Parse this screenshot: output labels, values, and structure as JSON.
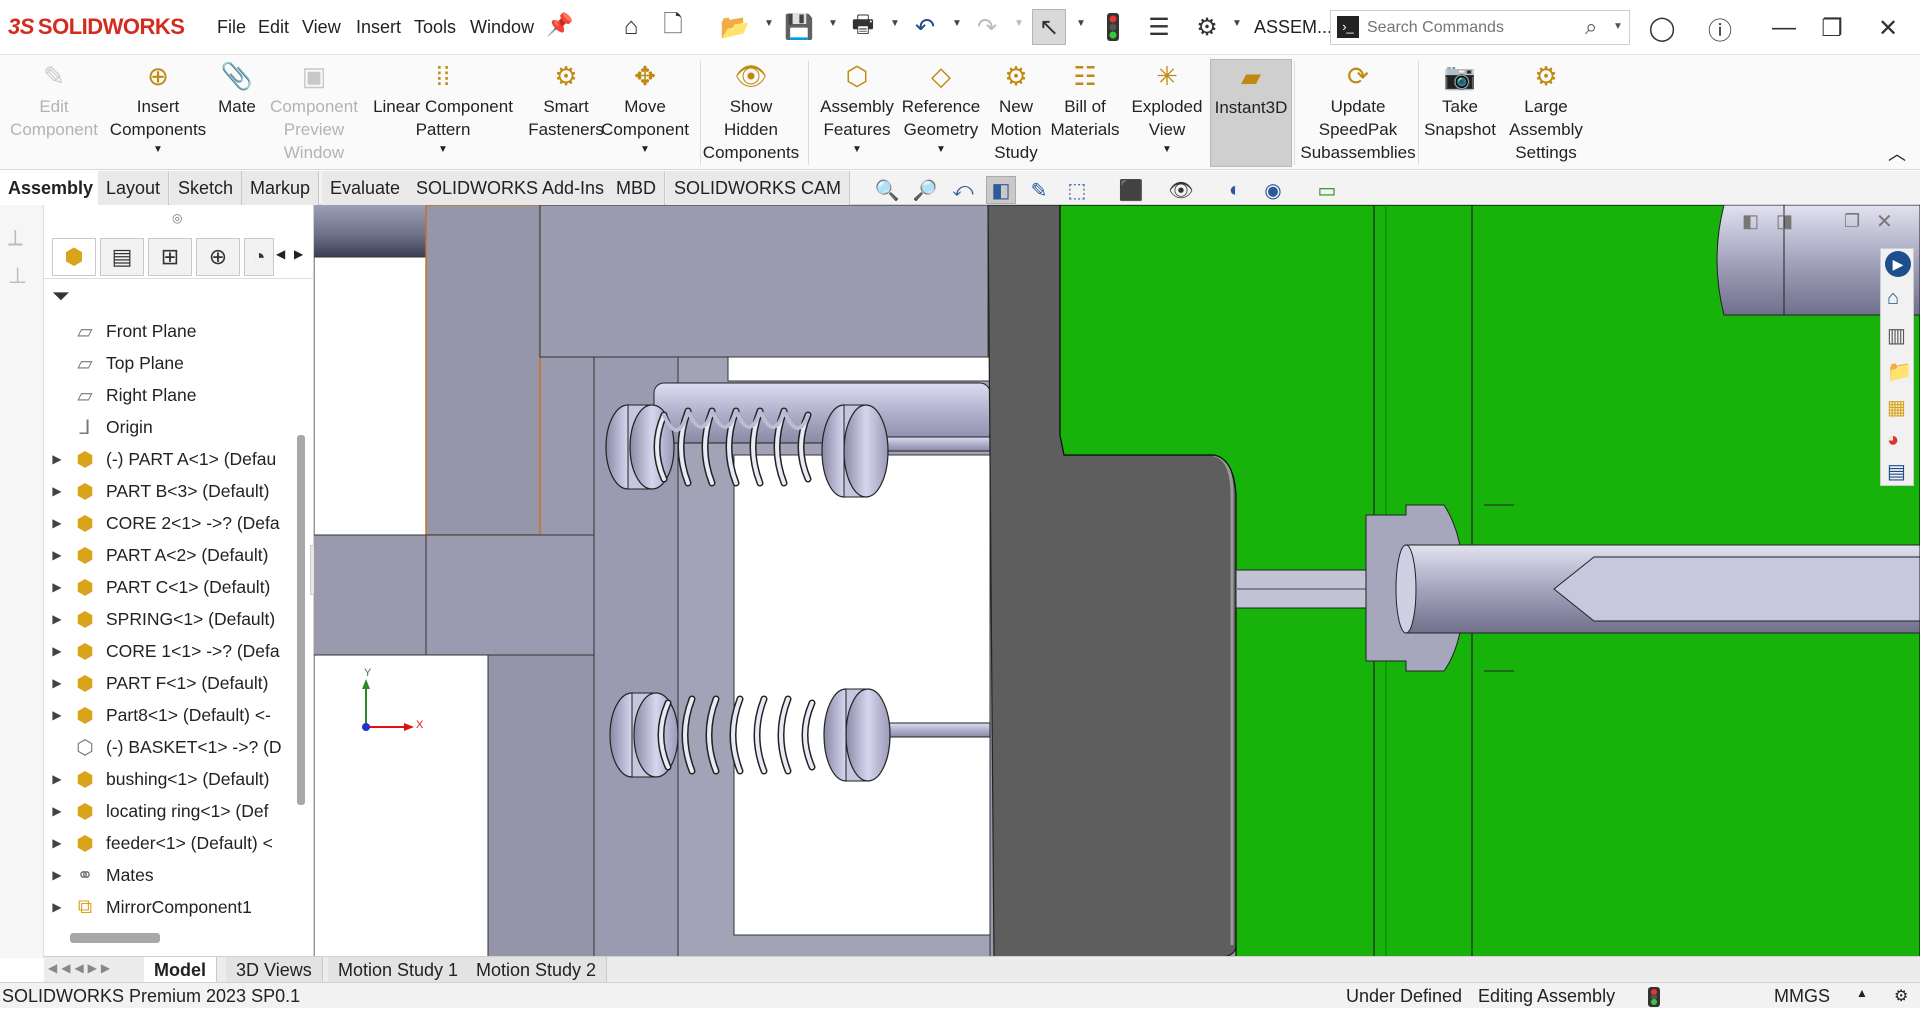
{
  "app": {
    "logo_prefix": "3S",
    "logo_text": "SOLIDWORKS",
    "document_title": "ASSEM..."
  },
  "menu": [
    "File",
    "Edit",
    "View",
    "Insert",
    "Tools",
    "Window"
  ],
  "search": {
    "placeholder": "Search Commands"
  },
  "ribbon": [
    {
      "label": "Edit\nComponent",
      "icon": "edit-component-icon",
      "disabled": true
    },
    {
      "label": "Insert\nComponents",
      "icon": "insert-components-icon",
      "caret": true
    },
    {
      "label": "Mate",
      "icon": "mate-icon"
    },
    {
      "label": "Component\nPreview\nWindow",
      "icon": "component-preview-icon",
      "disabled": true
    },
    {
      "label": "Linear Component\nPattern",
      "icon": "linear-pattern-icon",
      "caret": true
    },
    {
      "label": "Smart\nFasteners",
      "icon": "smart-fasteners-icon"
    },
    {
      "label": "Move\nComponent",
      "icon": "move-component-icon",
      "caret": true
    },
    {
      "label": "Show\nHidden\nComponents",
      "icon": "show-hidden-icon"
    },
    {
      "label": "Assembly\nFeatures",
      "icon": "assembly-features-icon",
      "caret": true
    },
    {
      "label": "Reference\nGeometry",
      "icon": "reference-geometry-icon",
      "caret": true
    },
    {
      "label": "New\nMotion\nStudy",
      "icon": "motion-study-icon"
    },
    {
      "label": "Bill of\nMaterials",
      "icon": "bom-icon"
    },
    {
      "label": "Exploded\nView",
      "icon": "exploded-view-icon",
      "caret": true
    },
    {
      "label": "Instant3D",
      "icon": "instant3d-icon",
      "active": true
    },
    {
      "label": "Update\nSpeedPak\nSubassemblies",
      "icon": "speedpak-icon"
    },
    {
      "label": "Take\nSnapshot",
      "icon": "snapshot-icon"
    },
    {
      "label": "Large\nAssembly\nSettings",
      "icon": "large-assembly-icon"
    }
  ],
  "command_tabs": [
    "Assembly",
    "Layout",
    "Sketch",
    "Markup",
    "Evaluate",
    "SOLIDWORKS Add-Ins",
    "MBD",
    "SOLIDWORKS CAM"
  ],
  "active_command_tab": "Assembly",
  "feature_tree": [
    {
      "label": "Front Plane",
      "type": "plane",
      "expandable": false
    },
    {
      "label": "Top Plane",
      "type": "plane",
      "expandable": false
    },
    {
      "label": "Right Plane",
      "type": "plane",
      "expandable": false
    },
    {
      "label": "Origin",
      "type": "origin",
      "expandable": false
    },
    {
      "label": "(-) PART A<1> (Defau",
      "type": "part",
      "expandable": true
    },
    {
      "label": "PART B<3> (Default)",
      "type": "part",
      "expandable": true
    },
    {
      "label": "CORE 2<1> ->? (Defa",
      "type": "part",
      "expandable": true
    },
    {
      "label": "PART A<2> (Default)",
      "type": "part",
      "expandable": true
    },
    {
      "label": "PART C<1> (Default)",
      "type": "part",
      "expandable": true
    },
    {
      "label": "SPRING<1> (Default)",
      "type": "part",
      "expandable": true
    },
    {
      "label": "CORE 1<1> ->? (Defa",
      "type": "part",
      "expandable": true
    },
    {
      "label": "PART F<1> (Default)",
      "type": "part",
      "expandable": true
    },
    {
      "label": "Part8<1> (Default) <-",
      "type": "part",
      "expandable": true
    },
    {
      "label": "(-) BASKET<1> ->? (D",
      "type": "part-hollow",
      "expandable": false
    },
    {
      "label": "bushing<1> (Default)",
      "type": "part",
      "expandable": true
    },
    {
      "label": "locating ring<1> (Def",
      "type": "part",
      "expandable": true
    },
    {
      "label": "feeder<1> (Default) <",
      "type": "part",
      "expandable": true
    },
    {
      "label": "Mates",
      "type": "mates",
      "expandable": true
    },
    {
      "label": "MirrorComponent1",
      "type": "mirror",
      "expandable": true
    }
  ],
  "triad": {
    "x_label": "X",
    "y_label": "Y"
  },
  "bottom_tabs": [
    "Model",
    "3D Views",
    "Motion Study 1",
    "Motion Study 2"
  ],
  "active_bottom_tab": "Model",
  "status": {
    "product": "SOLIDWORKS Premium 2023 SP0.1",
    "definition": "Under Defined",
    "mode": "Editing Assembly",
    "units": "MMGS"
  },
  "colors": {
    "accent_red": "#d52b1e",
    "part_yellow": "#d9a31a",
    "viewport_green": "#17b30a",
    "viewport_gray": "#9a9aaa"
  }
}
